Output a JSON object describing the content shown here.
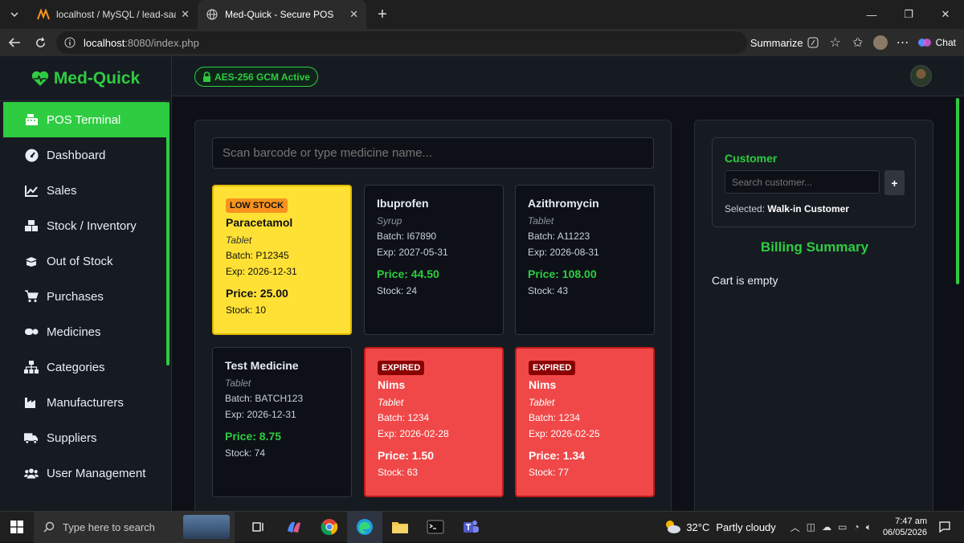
{
  "browser": {
    "tabs": [
      {
        "title": "localhost / MySQL / lead-saas / lea"
      },
      {
        "title": "Med-Quick - Secure POS"
      }
    ],
    "url_host": "localhost",
    "url_path": ":8080/index.php",
    "summarize_label": "Summarize",
    "chat_label": "Chat"
  },
  "app": {
    "brand": "Med-Quick",
    "security_badge": "AES-256 GCM Active",
    "colors": {
      "accent": "#2ecc40",
      "low_stock": "#ffe135",
      "expired": "#f04848"
    },
    "sidebar": [
      {
        "label": "POS Terminal",
        "icon": "cash-register-icon",
        "active": true
      },
      {
        "label": "Dashboard",
        "icon": "gauge-icon"
      },
      {
        "label": "Sales",
        "icon": "chart-line-icon"
      },
      {
        "label": "Stock / Inventory",
        "icon": "boxes-icon"
      },
      {
        "label": "Out of Stock",
        "icon": "box-open-icon"
      },
      {
        "label": "Purchases",
        "icon": "cart-icon"
      },
      {
        "label": "Medicines",
        "icon": "pills-icon"
      },
      {
        "label": "Categories",
        "icon": "sitemap-icon"
      },
      {
        "label": "Manufacturers",
        "icon": "industry-icon"
      },
      {
        "label": "Suppliers",
        "icon": "truck-icon"
      },
      {
        "label": "User Management",
        "icon": "users-icon"
      }
    ],
    "search_placeholder": "Scan barcode or type medicine name...",
    "products": [
      {
        "tag": "LOW STOCK",
        "name": "Paracetamol",
        "type": "Tablet",
        "batch": "Batch: P12345",
        "exp": "Exp: 2026-12-31",
        "price": "Price: 25.00",
        "stock": "Stock: 10",
        "status": "low"
      },
      {
        "tag": "",
        "name": "Ibuprofen",
        "type": "Syrup",
        "batch": "Batch: I67890",
        "exp": "Exp: 2027-05-31",
        "price": "Price: 44.50",
        "stock": "Stock: 24",
        "status": "ok"
      },
      {
        "tag": "",
        "name": "Azithromycin",
        "type": "Tablet",
        "batch": "Batch: A11223",
        "exp": "Exp: 2026-08-31",
        "price": "Price: 108.00",
        "stock": "Stock: 43",
        "status": "ok"
      },
      {
        "tag": "",
        "name": "Test Medicine",
        "type": "Tablet",
        "batch": "Batch: BATCH123",
        "exp": "Exp: 2026-12-31",
        "price": "Price: 8.75",
        "stock": "Stock: 74",
        "status": "ok"
      },
      {
        "tag": "EXPIRED",
        "name": "Nims",
        "type": "Tablet",
        "batch": "Batch: 1234",
        "exp": "Exp: 2026-02-28",
        "price": "Price: 1.50",
        "stock": "Stock: 63",
        "status": "expired"
      },
      {
        "tag": "EXPIRED",
        "name": "Nims",
        "type": "Tablet",
        "batch": "Batch: 1234",
        "exp": "Exp: 2026-02-25",
        "price": "Price: 1.34",
        "stock": "Stock: 77",
        "status": "expired"
      }
    ],
    "customer": {
      "label": "Customer",
      "search_placeholder": "Search customer...",
      "add_label": "+",
      "selected_prefix": "Selected:",
      "selected_name": "Walk-in Customer"
    },
    "billing": {
      "title": "Billing Summary",
      "empty_text": "Cart is empty"
    }
  },
  "taskbar": {
    "search_text": "Type here to search",
    "temperature": "32°C",
    "weather": "Partly cloudy",
    "time": "7:47 am",
    "date": "06/05/2026"
  }
}
